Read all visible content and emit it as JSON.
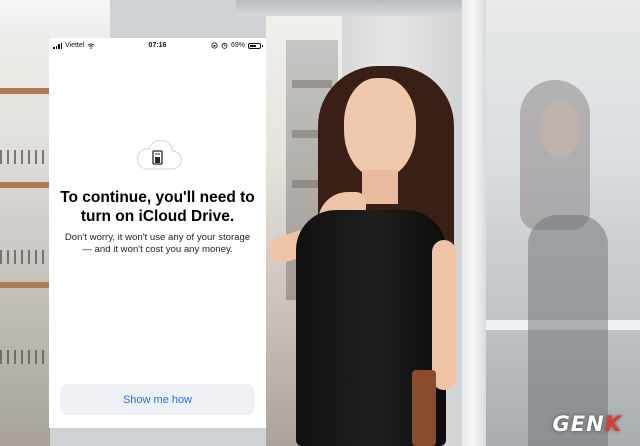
{
  "status_bar": {
    "carrier": "Viettel",
    "time": "07:16",
    "battery_percent": "69%",
    "battery_level": 0.69,
    "icons": [
      "signal-icon",
      "wifi-icon",
      "lock-rotation-icon",
      "alarm-icon",
      "battery-icon"
    ]
  },
  "screen": {
    "illustration_icon": "icloud-drive-icon",
    "title": "To continue, you'll need to turn on iCloud Drive.",
    "subtitle": "Don't worry, it won't use any of your storage — and it won't cost you any money.",
    "button_label": "Show me how"
  },
  "watermark": {
    "text_main": "GEN",
    "text_accent": "K"
  },
  "colors": {
    "accent": "#1677e6",
    "button_bg": "#f0f1f6",
    "watermark_accent": "#e23b2f"
  }
}
